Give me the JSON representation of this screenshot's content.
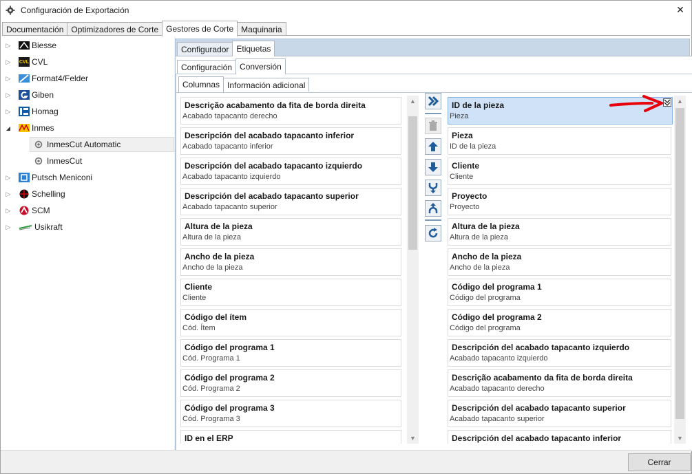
{
  "window": {
    "title": "Configuración de Exportación",
    "close_glyph": "✕"
  },
  "main_tabs": [
    {
      "label": "Documentación"
    },
    {
      "label": "Optimizadores de Corte"
    },
    {
      "label": "Gestores de Corte"
    },
    {
      "label": "Maquinaria"
    }
  ],
  "tree": [
    {
      "label": "Biesse"
    },
    {
      "label": "CVL",
      "logo_text": "CVL"
    },
    {
      "label": "Format4/Felder"
    },
    {
      "label": "Giben"
    },
    {
      "label": "Homag"
    },
    {
      "label": "Inmes"
    },
    {
      "label": "InmesCut Automatic"
    },
    {
      "label": "InmesCut"
    },
    {
      "label": "Putsch Meniconi"
    },
    {
      "label": "Schelling"
    },
    {
      "label": "SCM"
    },
    {
      "label": "Usikraft"
    }
  ],
  "sub_tabs_1": [
    {
      "label": "Configurador"
    },
    {
      "label": "Etiquetas"
    }
  ],
  "sub_tabs_2": [
    {
      "label": "Configuración"
    },
    {
      "label": "Conversión"
    }
  ],
  "sub_tabs_3": [
    {
      "label": "Columnas"
    },
    {
      "label": "Información adicional"
    }
  ],
  "left_list": [
    {
      "title": "Descrição acabamento da fita de borda direita",
      "sub": "Acabado tapacanto derecho"
    },
    {
      "title": "Descripción del acabado tapacanto inferior",
      "sub": "Acabado tapacanto inferior"
    },
    {
      "title": "Descripción del acabado tapacanto izquierdo",
      "sub": "Acabado tapacanto izquierdo"
    },
    {
      "title": "Descripción del acabado tapacanto superior",
      "sub": "Acabado tapacanto superior"
    },
    {
      "title": "Altura de la pieza",
      "sub": "Altura de la pieza"
    },
    {
      "title": "Ancho de la pieza",
      "sub": "Ancho de la pieza"
    },
    {
      "title": "Cliente",
      "sub": "Cliente"
    },
    {
      "title": "Código del ítem",
      "sub": "Cód. Ítem"
    },
    {
      "title": "Código del programa 1",
      "sub": "Cód. Programa 1"
    },
    {
      "title": "Código del programa 2",
      "sub": "Cód. Programa 2"
    },
    {
      "title": "Código del programa 3",
      "sub": "Cód. Programa 3"
    },
    {
      "title": "ID en el ERP",
      "sub": ""
    }
  ],
  "right_list": [
    {
      "title": "ID de la pieza",
      "sub": "Pieza"
    },
    {
      "title": "Pieza",
      "sub": "ID de la pieza"
    },
    {
      "title": "Cliente",
      "sub": "Cliente"
    },
    {
      "title": "Proyecto",
      "sub": "Proyecto"
    },
    {
      "title": "Altura de la pieza",
      "sub": "Altura de la pieza"
    },
    {
      "title": "Ancho de la pieza",
      "sub": "Ancho de la pieza"
    },
    {
      "title": "Código del programa 1",
      "sub": "Código del programa"
    },
    {
      "title": "Código del programa 2",
      "sub": "Código del programa"
    },
    {
      "title": "Descripción del acabado tapacanto izquierdo",
      "sub": "Acabado tapacanto izquierdo"
    },
    {
      "title": "Descrição acabamento da fita de borda direita",
      "sub": "Acabado tapacanto derecho"
    },
    {
      "title": "Descripción del acabado tapacanto superior",
      "sub": "Acabado tapacanto superior"
    },
    {
      "title": "Descripción del acabado tapacanto inferior",
      "sub": ""
    }
  ],
  "toolbar_icons": [
    "move-all-right-icon",
    "trash-icon",
    "arrow-up-icon",
    "arrow-down-icon",
    "merge-icon",
    "split-icon",
    "refresh-icon"
  ],
  "scroll_glyphs": {
    "up": "▲",
    "down": "▼"
  },
  "tree_glyphs": {
    "collapsed": "▷",
    "expanded": "◢"
  },
  "footer": {
    "close_label": "Cerrar"
  },
  "colors": {
    "accent": "#1f5c99",
    "panel_bg": "#c9d8e9",
    "selected_bg": "#cfe2f8",
    "annotation_arrow": "#e8000b"
  }
}
